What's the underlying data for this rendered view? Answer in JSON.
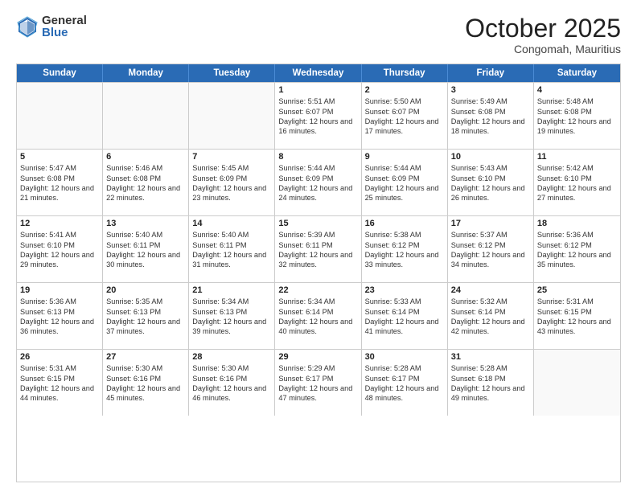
{
  "header": {
    "logo_general": "General",
    "logo_blue": "Blue",
    "month": "October 2025",
    "location": "Congomah, Mauritius"
  },
  "weekdays": [
    "Sunday",
    "Monday",
    "Tuesday",
    "Wednesday",
    "Thursday",
    "Friday",
    "Saturday"
  ],
  "weeks": [
    [
      {
        "day": "",
        "sunrise": "",
        "sunset": "",
        "daylight": ""
      },
      {
        "day": "",
        "sunrise": "",
        "sunset": "",
        "daylight": ""
      },
      {
        "day": "",
        "sunrise": "",
        "sunset": "",
        "daylight": ""
      },
      {
        "day": "1",
        "sunrise": "Sunrise: 5:51 AM",
        "sunset": "Sunset: 6:07 PM",
        "daylight": "Daylight: 12 hours and 16 minutes."
      },
      {
        "day": "2",
        "sunrise": "Sunrise: 5:50 AM",
        "sunset": "Sunset: 6:07 PM",
        "daylight": "Daylight: 12 hours and 17 minutes."
      },
      {
        "day": "3",
        "sunrise": "Sunrise: 5:49 AM",
        "sunset": "Sunset: 6:08 PM",
        "daylight": "Daylight: 12 hours and 18 minutes."
      },
      {
        "day": "4",
        "sunrise": "Sunrise: 5:48 AM",
        "sunset": "Sunset: 6:08 PM",
        "daylight": "Daylight: 12 hours and 19 minutes."
      }
    ],
    [
      {
        "day": "5",
        "sunrise": "Sunrise: 5:47 AM",
        "sunset": "Sunset: 6:08 PM",
        "daylight": "Daylight: 12 hours and 21 minutes."
      },
      {
        "day": "6",
        "sunrise": "Sunrise: 5:46 AM",
        "sunset": "Sunset: 6:08 PM",
        "daylight": "Daylight: 12 hours and 22 minutes."
      },
      {
        "day": "7",
        "sunrise": "Sunrise: 5:45 AM",
        "sunset": "Sunset: 6:09 PM",
        "daylight": "Daylight: 12 hours and 23 minutes."
      },
      {
        "day": "8",
        "sunrise": "Sunrise: 5:44 AM",
        "sunset": "Sunset: 6:09 PM",
        "daylight": "Daylight: 12 hours and 24 minutes."
      },
      {
        "day": "9",
        "sunrise": "Sunrise: 5:44 AM",
        "sunset": "Sunset: 6:09 PM",
        "daylight": "Daylight: 12 hours and 25 minutes."
      },
      {
        "day": "10",
        "sunrise": "Sunrise: 5:43 AM",
        "sunset": "Sunset: 6:10 PM",
        "daylight": "Daylight: 12 hours and 26 minutes."
      },
      {
        "day": "11",
        "sunrise": "Sunrise: 5:42 AM",
        "sunset": "Sunset: 6:10 PM",
        "daylight": "Daylight: 12 hours and 27 minutes."
      }
    ],
    [
      {
        "day": "12",
        "sunrise": "Sunrise: 5:41 AM",
        "sunset": "Sunset: 6:10 PM",
        "daylight": "Daylight: 12 hours and 29 minutes."
      },
      {
        "day": "13",
        "sunrise": "Sunrise: 5:40 AM",
        "sunset": "Sunset: 6:11 PM",
        "daylight": "Daylight: 12 hours and 30 minutes."
      },
      {
        "day": "14",
        "sunrise": "Sunrise: 5:40 AM",
        "sunset": "Sunset: 6:11 PM",
        "daylight": "Daylight: 12 hours and 31 minutes."
      },
      {
        "day": "15",
        "sunrise": "Sunrise: 5:39 AM",
        "sunset": "Sunset: 6:11 PM",
        "daylight": "Daylight: 12 hours and 32 minutes."
      },
      {
        "day": "16",
        "sunrise": "Sunrise: 5:38 AM",
        "sunset": "Sunset: 6:12 PM",
        "daylight": "Daylight: 12 hours and 33 minutes."
      },
      {
        "day": "17",
        "sunrise": "Sunrise: 5:37 AM",
        "sunset": "Sunset: 6:12 PM",
        "daylight": "Daylight: 12 hours and 34 minutes."
      },
      {
        "day": "18",
        "sunrise": "Sunrise: 5:36 AM",
        "sunset": "Sunset: 6:12 PM",
        "daylight": "Daylight: 12 hours and 35 minutes."
      }
    ],
    [
      {
        "day": "19",
        "sunrise": "Sunrise: 5:36 AM",
        "sunset": "Sunset: 6:13 PM",
        "daylight": "Daylight: 12 hours and 36 minutes."
      },
      {
        "day": "20",
        "sunrise": "Sunrise: 5:35 AM",
        "sunset": "Sunset: 6:13 PM",
        "daylight": "Daylight: 12 hours and 37 minutes."
      },
      {
        "day": "21",
        "sunrise": "Sunrise: 5:34 AM",
        "sunset": "Sunset: 6:13 PM",
        "daylight": "Daylight: 12 hours and 39 minutes."
      },
      {
        "day": "22",
        "sunrise": "Sunrise: 5:34 AM",
        "sunset": "Sunset: 6:14 PM",
        "daylight": "Daylight: 12 hours and 40 minutes."
      },
      {
        "day": "23",
        "sunrise": "Sunrise: 5:33 AM",
        "sunset": "Sunset: 6:14 PM",
        "daylight": "Daylight: 12 hours and 41 minutes."
      },
      {
        "day": "24",
        "sunrise": "Sunrise: 5:32 AM",
        "sunset": "Sunset: 6:14 PM",
        "daylight": "Daylight: 12 hours and 42 minutes."
      },
      {
        "day": "25",
        "sunrise": "Sunrise: 5:31 AM",
        "sunset": "Sunset: 6:15 PM",
        "daylight": "Daylight: 12 hours and 43 minutes."
      }
    ],
    [
      {
        "day": "26",
        "sunrise": "Sunrise: 5:31 AM",
        "sunset": "Sunset: 6:15 PM",
        "daylight": "Daylight: 12 hours and 44 minutes."
      },
      {
        "day": "27",
        "sunrise": "Sunrise: 5:30 AM",
        "sunset": "Sunset: 6:16 PM",
        "daylight": "Daylight: 12 hours and 45 minutes."
      },
      {
        "day": "28",
        "sunrise": "Sunrise: 5:30 AM",
        "sunset": "Sunset: 6:16 PM",
        "daylight": "Daylight: 12 hours and 46 minutes."
      },
      {
        "day": "29",
        "sunrise": "Sunrise: 5:29 AM",
        "sunset": "Sunset: 6:17 PM",
        "daylight": "Daylight: 12 hours and 47 minutes."
      },
      {
        "day": "30",
        "sunrise": "Sunrise: 5:28 AM",
        "sunset": "Sunset: 6:17 PM",
        "daylight": "Daylight: 12 hours and 48 minutes."
      },
      {
        "day": "31",
        "sunrise": "Sunrise: 5:28 AM",
        "sunset": "Sunset: 6:18 PM",
        "daylight": "Daylight: 12 hours and 49 minutes."
      },
      {
        "day": "",
        "sunrise": "",
        "sunset": "",
        "daylight": ""
      }
    ]
  ]
}
